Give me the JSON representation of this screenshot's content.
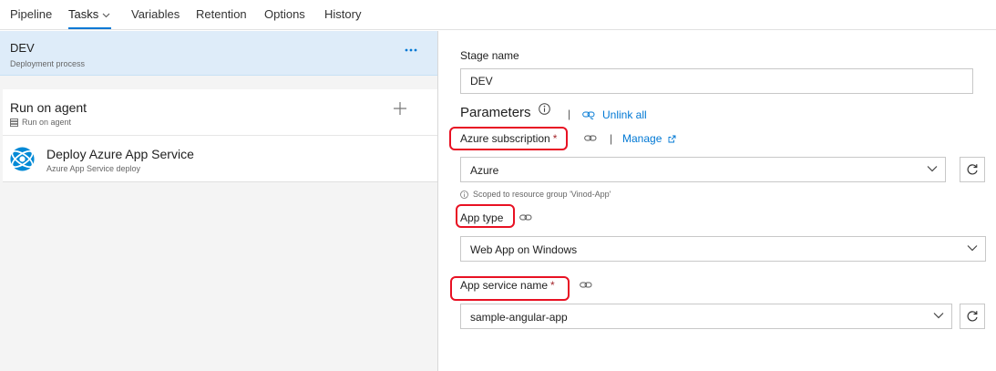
{
  "tabs": {
    "pipeline": "Pipeline",
    "tasks": "Tasks",
    "variables": "Variables",
    "retention": "Retention",
    "options": "Options",
    "history": "History"
  },
  "stage": {
    "title": "DEV",
    "subtitle": "Deployment process"
  },
  "job": {
    "title": "Run on agent",
    "subtitle": "Run on agent"
  },
  "task": {
    "title": "Deploy Azure App Service",
    "subtitle": "Azure App Service deploy"
  },
  "form": {
    "stage_name_label": "Stage name",
    "stage_name_value": "DEV",
    "parameters_heading": "Parameters",
    "unlink_all": "Unlink all",
    "azure_sub_label": "Azure subscription",
    "required_mark": "*",
    "manage_link": "Manage",
    "azure_sub_value": "Azure",
    "scope_hint": "Scoped to resource group 'Vinod-App'",
    "app_type_label": "App type",
    "app_type_value": "Web App on Windows",
    "app_service_label": "App service name",
    "app_service_value": "sample-angular-app",
    "separator": "|"
  },
  "colors": {
    "accent": "#0078d4",
    "highlight": "#e81123",
    "stage_bg": "#deecf9"
  }
}
